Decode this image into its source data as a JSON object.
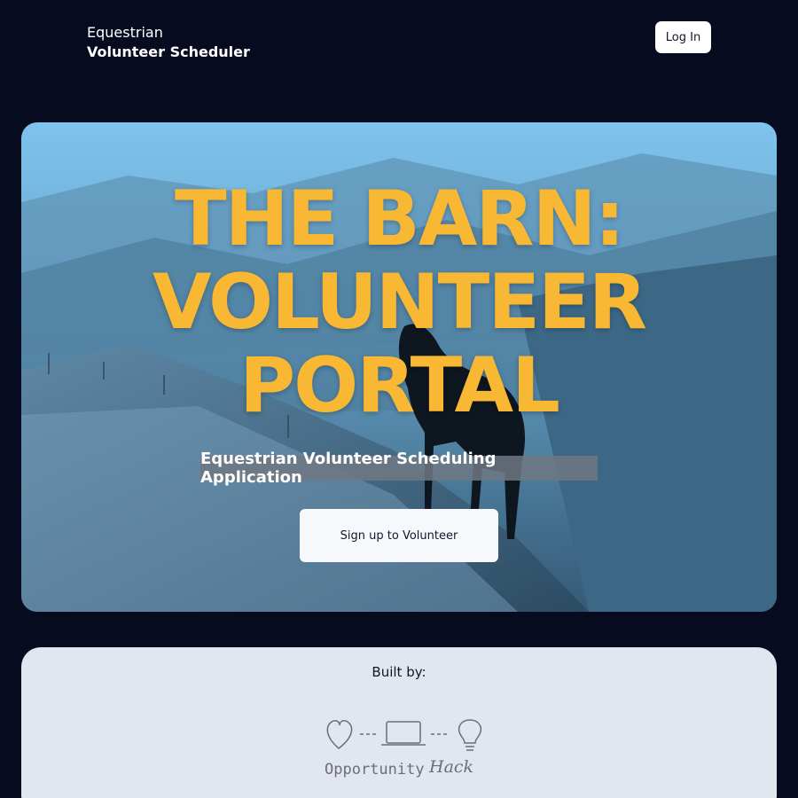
{
  "header": {
    "brand_line1": "Equestrian",
    "brand_line2": "Volunteer Scheduler",
    "login_label": "Log In"
  },
  "hero": {
    "title_lines": [
      "THE BARN:",
      "VOLUNTEER",
      "PORTAL"
    ],
    "subtitle": "Equestrian Volunteer Scheduling Application",
    "signup_label": "Sign up to Volunteer"
  },
  "built_by": {
    "label": "Built by:",
    "logo_word1": "Opportunity",
    "logo_word2": "Hack"
  },
  "colors": {
    "background": "#070b1f",
    "title_accent": "#f8b834",
    "card": "#e2e7ef"
  }
}
